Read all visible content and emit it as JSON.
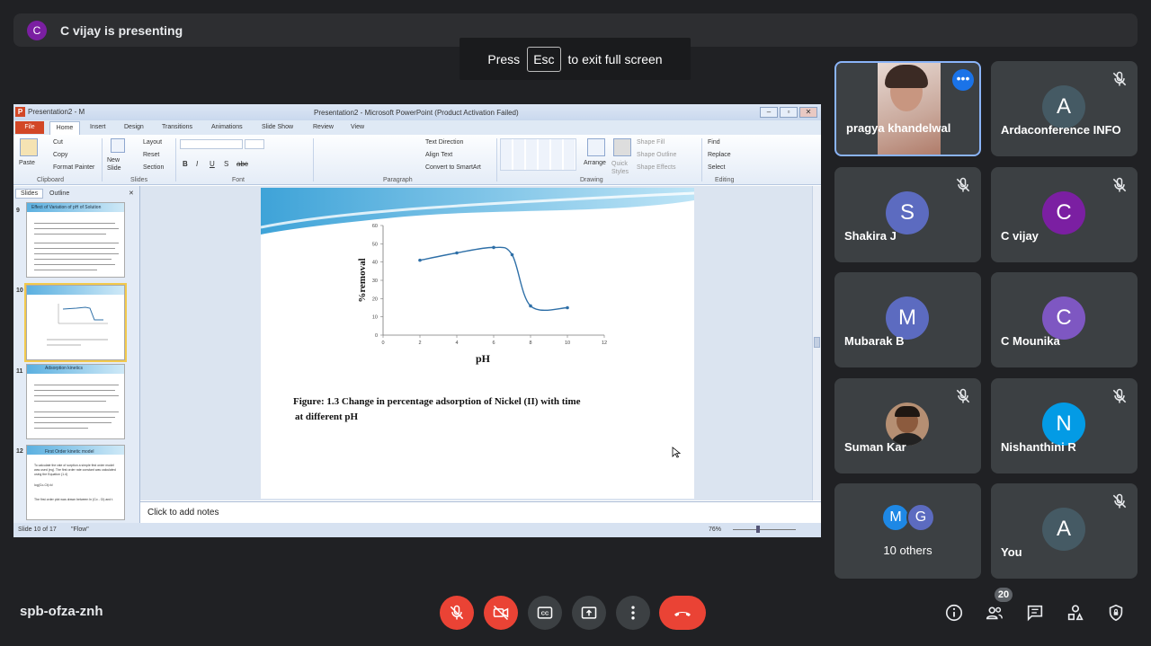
{
  "presenter_bar": {
    "avatar_initial": "C",
    "text": "C vijay is presenting"
  },
  "fullscreen_hint": {
    "press": "Press",
    "key": "Esc",
    "rest": "to exit full screen"
  },
  "ppt": {
    "window_title_left": "Presentation2 - M",
    "window_title": "Presentation2 - Microsoft PowerPoint (Product Activation Failed)",
    "tabs": [
      "File",
      "Home",
      "Insert",
      "Design",
      "Transitions",
      "Animations",
      "Slide Show",
      "Review",
      "View"
    ],
    "ribbon": {
      "paste": "Paste",
      "cut": "Cut",
      "copy": "Copy",
      "format_painter": "Format Painter",
      "new_slide": "New Slide",
      "layout": "Layout",
      "reset": "Reset",
      "section": "Section",
      "text_direction": "Text Direction",
      "align_text": "Align Text",
      "convert_smartart": "Convert to SmartArt",
      "arrange": "Arrange",
      "quick_styles": "Quick Styles",
      "shape_fill": "Shape Fill",
      "shape_outline": "Shape Outline",
      "shape_effects": "Shape Effects",
      "find": "Find",
      "replace": "Replace",
      "select": "Select",
      "groups": [
        "Clipboard",
        "Slides",
        "Font",
        "Paragraph",
        "Drawing",
        "Editing"
      ]
    },
    "pane_tabs": [
      "Slides",
      "Outline"
    ],
    "thumbnails": [
      {
        "num": "9",
        "title": "Effect of Variation of pH of Solution"
      },
      {
        "num": "10",
        "title": ""
      },
      {
        "num": "11",
        "title": "Adsorption kinetics"
      },
      {
        "num": "12",
        "title": "First Order kinetic model"
      }
    ],
    "thumb12_text": [
      "To calculate the rate of sorption a simple first order model was used (eq). The first order rate constant was calculated using the Equation (1.4)",
      "log(Co-Ct)=k/",
      "The first order plot was drawn between ln (Co - Ct) and t."
    ],
    "notes_placeholder": "Click to add notes",
    "status": {
      "slide": "Slide 10 of 17",
      "theme": "\"Flow\"",
      "zoom": "76%"
    },
    "figure_caption_line1": "Figure: 1.3 Change in percentage adsorption  of Nickel (II) with time",
    "figure_caption_line2": "at different pH"
  },
  "chart_data": {
    "type": "line",
    "title": "",
    "xlabel": "pH",
    "ylabel": "%removal",
    "x": [
      2,
      4,
      6,
      7,
      8,
      10
    ],
    "series": [
      {
        "values": [
          41,
          45,
          48,
          44,
          16,
          15
        ]
      }
    ],
    "xlim": [
      0,
      12
    ],
    "ylim": [
      0,
      60
    ],
    "xticks": [
      "0",
      "2",
      "4",
      "6",
      "8",
      "10",
      "12"
    ],
    "yticks": [
      "0",
      "10",
      "20",
      "30",
      "40",
      "50",
      "60"
    ],
    "grid": false,
    "legend": "none",
    "line_color": "#2e6fa7"
  },
  "participants": [
    {
      "name": "pragya khandelwal",
      "type": "video",
      "active": true
    },
    {
      "name": "Ardaconference INFO",
      "initial": "A",
      "color": "#455a64",
      "muted": true
    },
    {
      "name": "Shakira J",
      "initial": "S",
      "color": "#5c6bc0",
      "muted": true
    },
    {
      "name": "C vijay",
      "initial": "C",
      "color": "#7b1fa2",
      "muted": true
    },
    {
      "name": "Mubarak B",
      "initial": "M",
      "color": "#5c6bc0",
      "muted": false
    },
    {
      "name": "C Mounika",
      "initial": "C",
      "color": "#7e57c2",
      "muted": false
    },
    {
      "name": "Suman Kar",
      "type": "photo",
      "muted": true
    },
    {
      "name": "Nishanthini R",
      "initial": "N",
      "color": "#039be5",
      "muted": true
    },
    {
      "name": "10 others",
      "type": "others",
      "initials": [
        "M",
        "G"
      ],
      "colors": [
        "#1e88e5",
        "#5c6bc0"
      ]
    },
    {
      "name": "You",
      "initial": "A",
      "color": "#455a64",
      "muted": true
    }
  ],
  "bottom": {
    "meeting_code": "spb-ofza-znh",
    "people_count": "20"
  },
  "colors": {
    "end_call": "#ea4335",
    "muted": "#ea4335",
    "control_bg": "#3c4043",
    "active_border": "#8ab4f8"
  }
}
